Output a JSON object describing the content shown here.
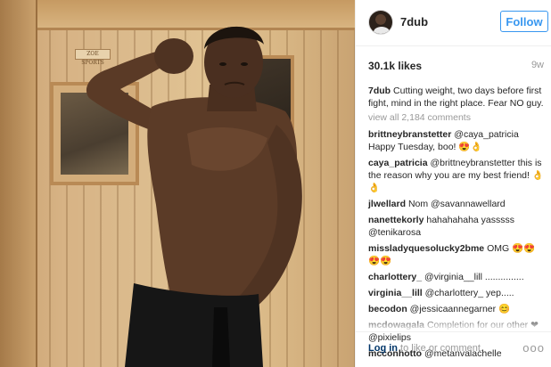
{
  "post": {
    "username": "7dub",
    "follow_label": "Follow",
    "likes": "30.1k likes",
    "time_ago": "9w",
    "plaque_text": "ZOE SPORTS",
    "caption": {
      "user": "7dub",
      "text": "Cutting weight, two days before first fight, mind in the right place. Fear NO guy."
    },
    "view_all": "view all 2,184 comments",
    "comments": [
      {
        "user": "brittneybranstetter",
        "text": "@caya_patricia Happy Tuesday, boo! 😍👌"
      },
      {
        "user": "caya_patricia",
        "text": "@brittneybranstetter this is the reason why you are my best friend! 👌👌"
      },
      {
        "user": "jlwellard",
        "text": "Nom @savannawellard"
      },
      {
        "user": "nanettekorly",
        "text": "hahahahaha yasssss @tenikarosa"
      },
      {
        "user": "missladyquesolucky2bme",
        "text": "OMG 😍😍😍😍"
      },
      {
        "user": "charlottery_",
        "text": "@virginia__lill ..............."
      },
      {
        "user": "virginia__lill",
        "text": "@charlottery_ yep....."
      },
      {
        "user": "becodon",
        "text": "@jessicaannegarner 😊"
      },
      {
        "user": "mcdowagala",
        "text": "Completion for our other ❤ @pixielips"
      },
      {
        "user": "mcconhotto",
        "text": "@metanvalachelle"
      }
    ],
    "footer": {
      "login_link": "Log in",
      "login_rest": " to like or comment.",
      "more_icon": "more-options-icon",
      "more_glyph": "ooo"
    }
  },
  "colors": {
    "accent": "#3897f0",
    "text": "#262626",
    "muted": "#999999",
    "heart": "#e0245e"
  }
}
